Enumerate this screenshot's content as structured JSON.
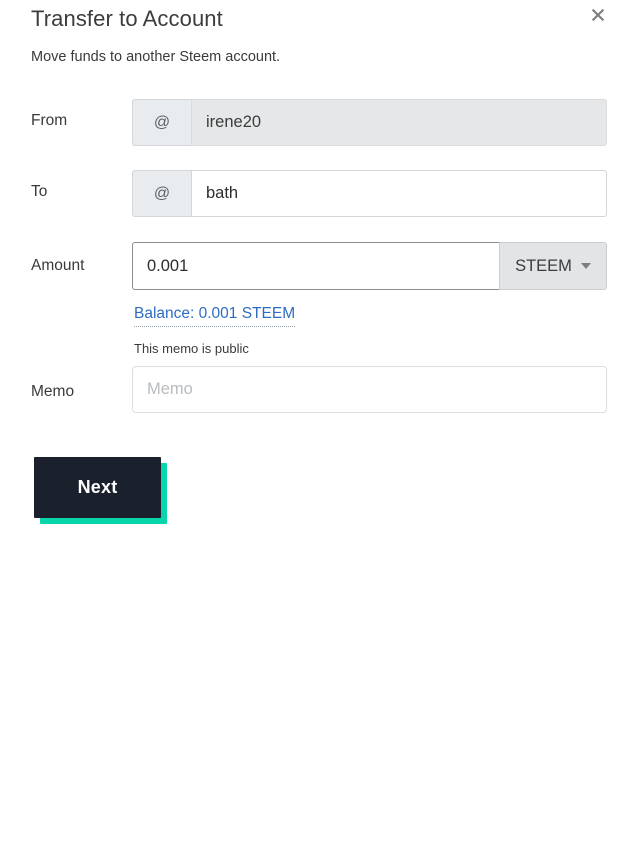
{
  "dialog": {
    "title": "Transfer to Account",
    "subtitle": "Move funds to another Steem account.",
    "close_icon": "close-icon"
  },
  "form": {
    "from": {
      "label": "From",
      "prefix": "@",
      "value": "irene20",
      "placeholder": ""
    },
    "to": {
      "label": "To",
      "prefix": "@",
      "value": "bath",
      "placeholder": ""
    },
    "amount": {
      "label": "Amount",
      "value": "0.001",
      "placeholder": "",
      "currency": "STEEM",
      "caret_icon": "chevron-down-icon",
      "balance_link": "Balance: 0.001 STEEM"
    },
    "memo": {
      "label": "Memo",
      "hint": "This memo is public",
      "value": "",
      "placeholder": "Memo"
    }
  },
  "actions": {
    "next_label": "Next"
  },
  "colors": {
    "accent": "#06d6a9",
    "button_bg": "#1a202c",
    "link": "#2e6cc4",
    "disabled_bg": "#e6e7e8",
    "prefix_bg": "#e9ecef"
  }
}
